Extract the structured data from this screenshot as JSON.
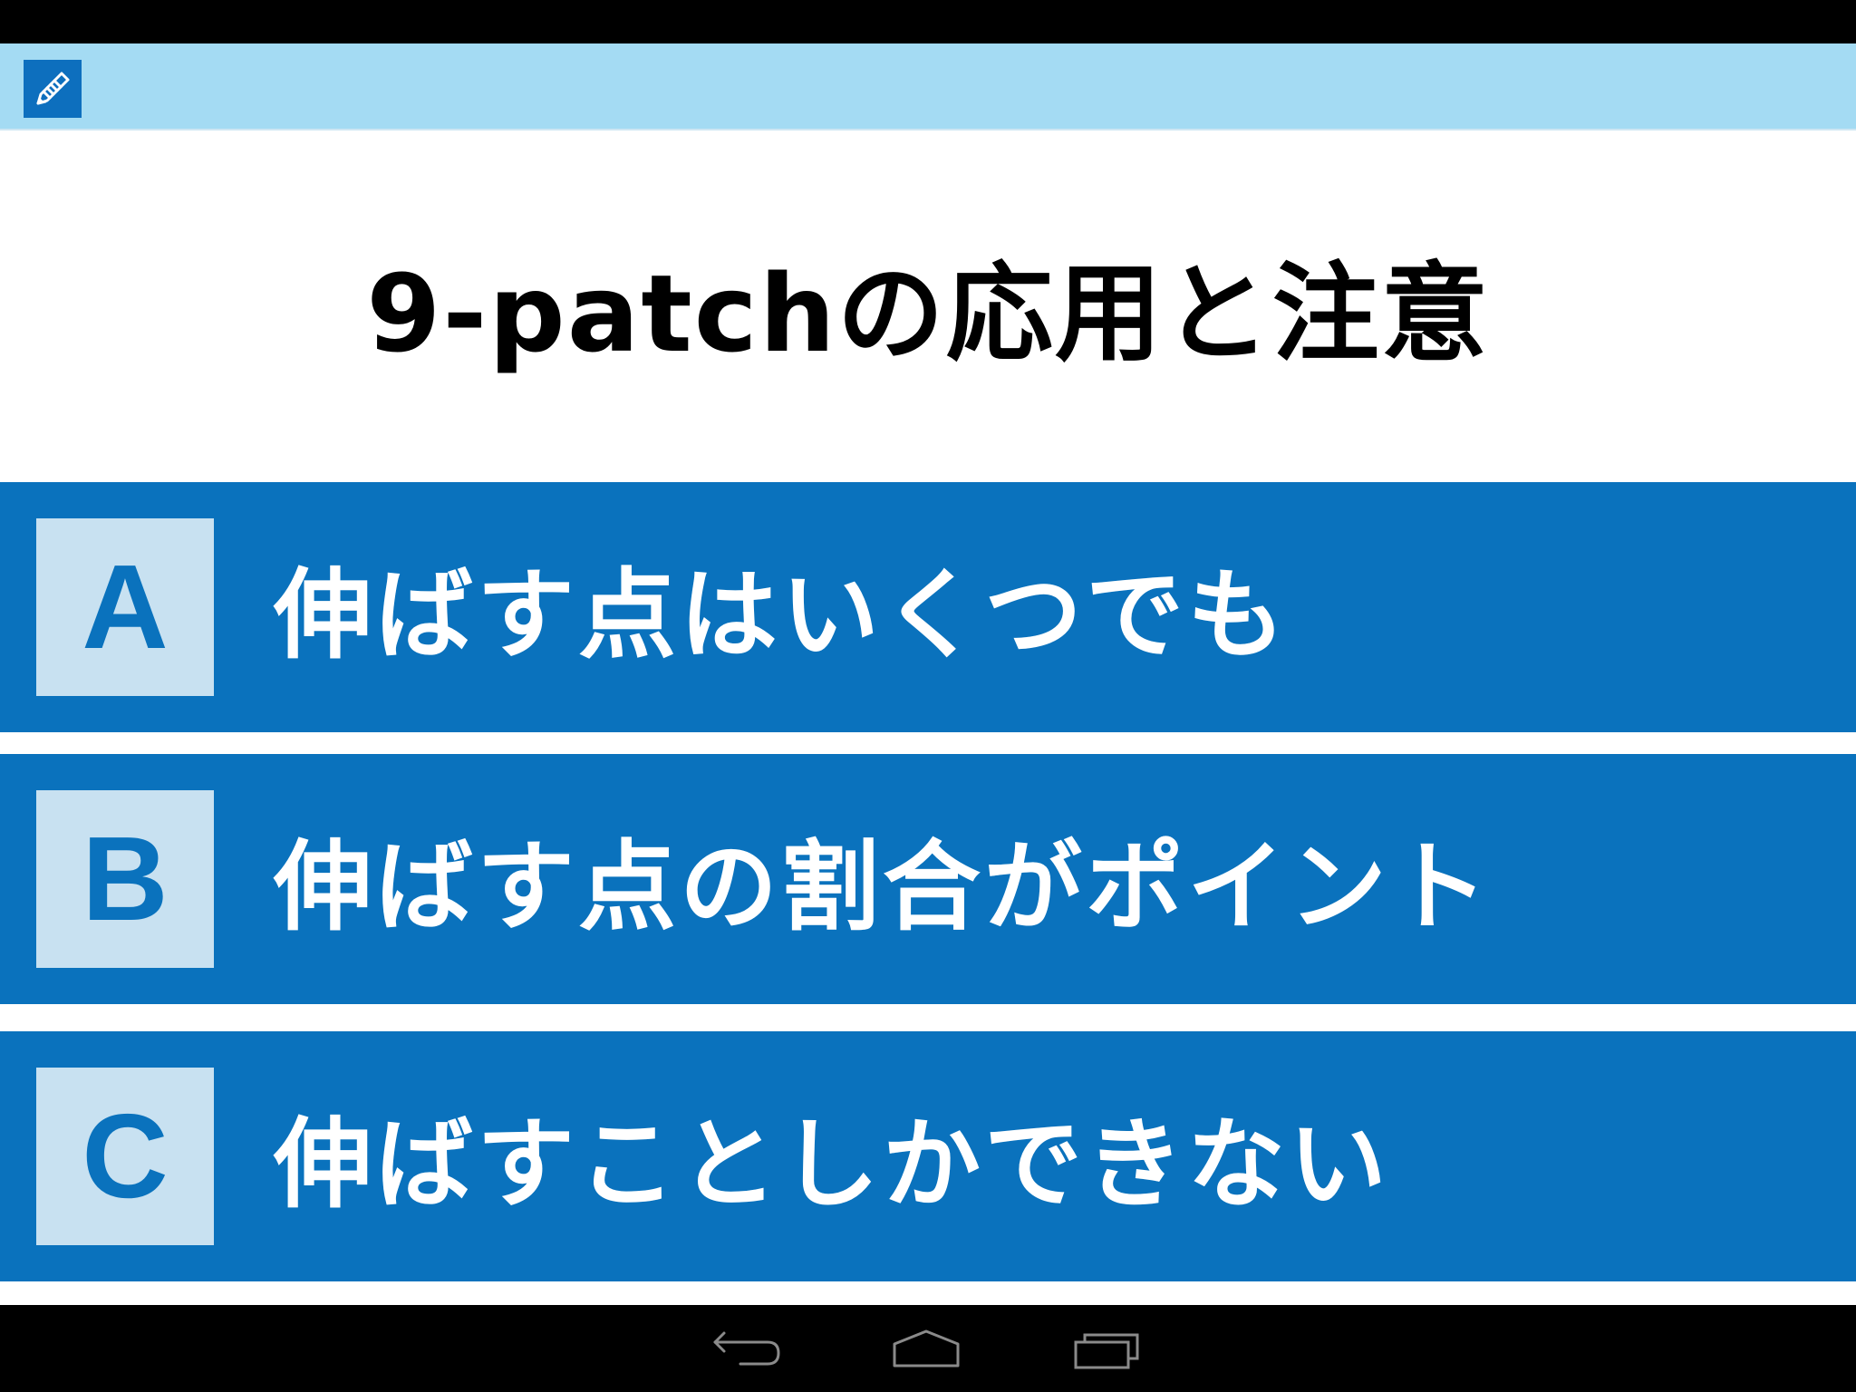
{
  "question": {
    "title": "9-patchの応用と注意"
  },
  "answers": [
    {
      "letter": "A",
      "text": "伸ばす点はいくつでも"
    },
    {
      "letter": "B",
      "text": "伸ばす点の割合がポイント"
    },
    {
      "letter": "C",
      "text": "伸ばすことしかできない"
    }
  ],
  "icons": {
    "app": "pencil-icon",
    "nav_back": "back-icon",
    "nav_home": "home-icon",
    "nav_recents": "recents-icon"
  },
  "colors": {
    "action_bar": "#a4dbf3",
    "answer_background": "#0a72bd",
    "letter_box": "#c8e1f1",
    "app_icon": "#0d6fbe"
  }
}
